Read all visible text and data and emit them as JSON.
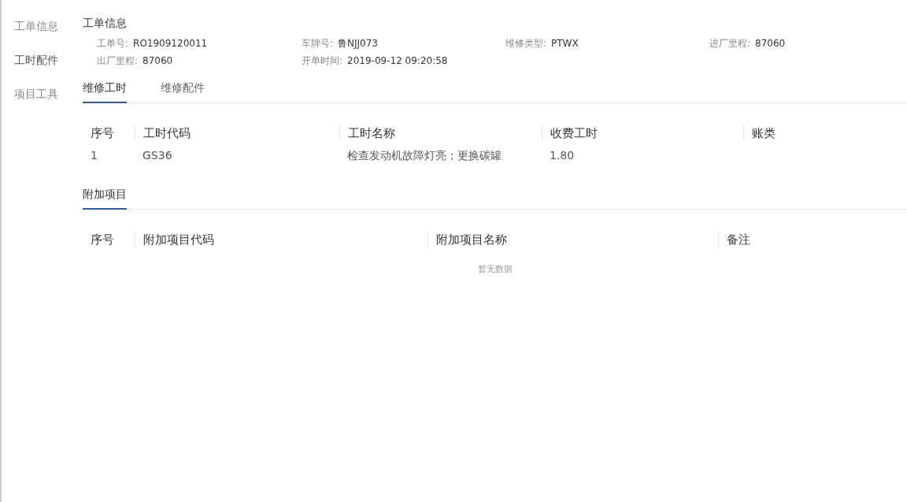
{
  "sidebar": {
    "items": [
      {
        "label": "工单信息",
        "selected": false
      },
      {
        "label": "工时配件",
        "selected": true
      },
      {
        "label": "项目工具",
        "selected": false
      }
    ]
  },
  "section_title": "工单信息",
  "info_fields": [
    {
      "label": "工单号:",
      "value": "RO1909120011"
    },
    {
      "label": "车牌号:",
      "value": "鲁NJJ073"
    },
    {
      "label": "维修类型:",
      "value": "PTWX"
    },
    {
      "label": "进厂里程:",
      "value": "87060"
    },
    {
      "label": "出厂里程:",
      "value": "87060"
    },
    {
      "label": "开单时间:",
      "value": "2019-09-12 09:20:58"
    }
  ],
  "tabs": [
    {
      "label": "维修工时",
      "selected": true
    },
    {
      "label": "维修配件",
      "selected": false
    }
  ],
  "labor_table": {
    "columns": [
      "序号",
      "工时代码",
      "工时名称",
      "收费工时",
      "账类"
    ],
    "rows": [
      [
        "1",
        "GS36",
        "检查发动机故障灯亮；更换碳罐",
        "1.80"
      ]
    ]
  },
  "extra_tabs": [
    {
      "label": "附加项目",
      "selected": true
    }
  ],
  "extra_table": {
    "columns": [
      "序号",
      "附加项目代码",
      "附加项目名称",
      "备注"
    ],
    "empty_text": "暂无数据"
  }
}
